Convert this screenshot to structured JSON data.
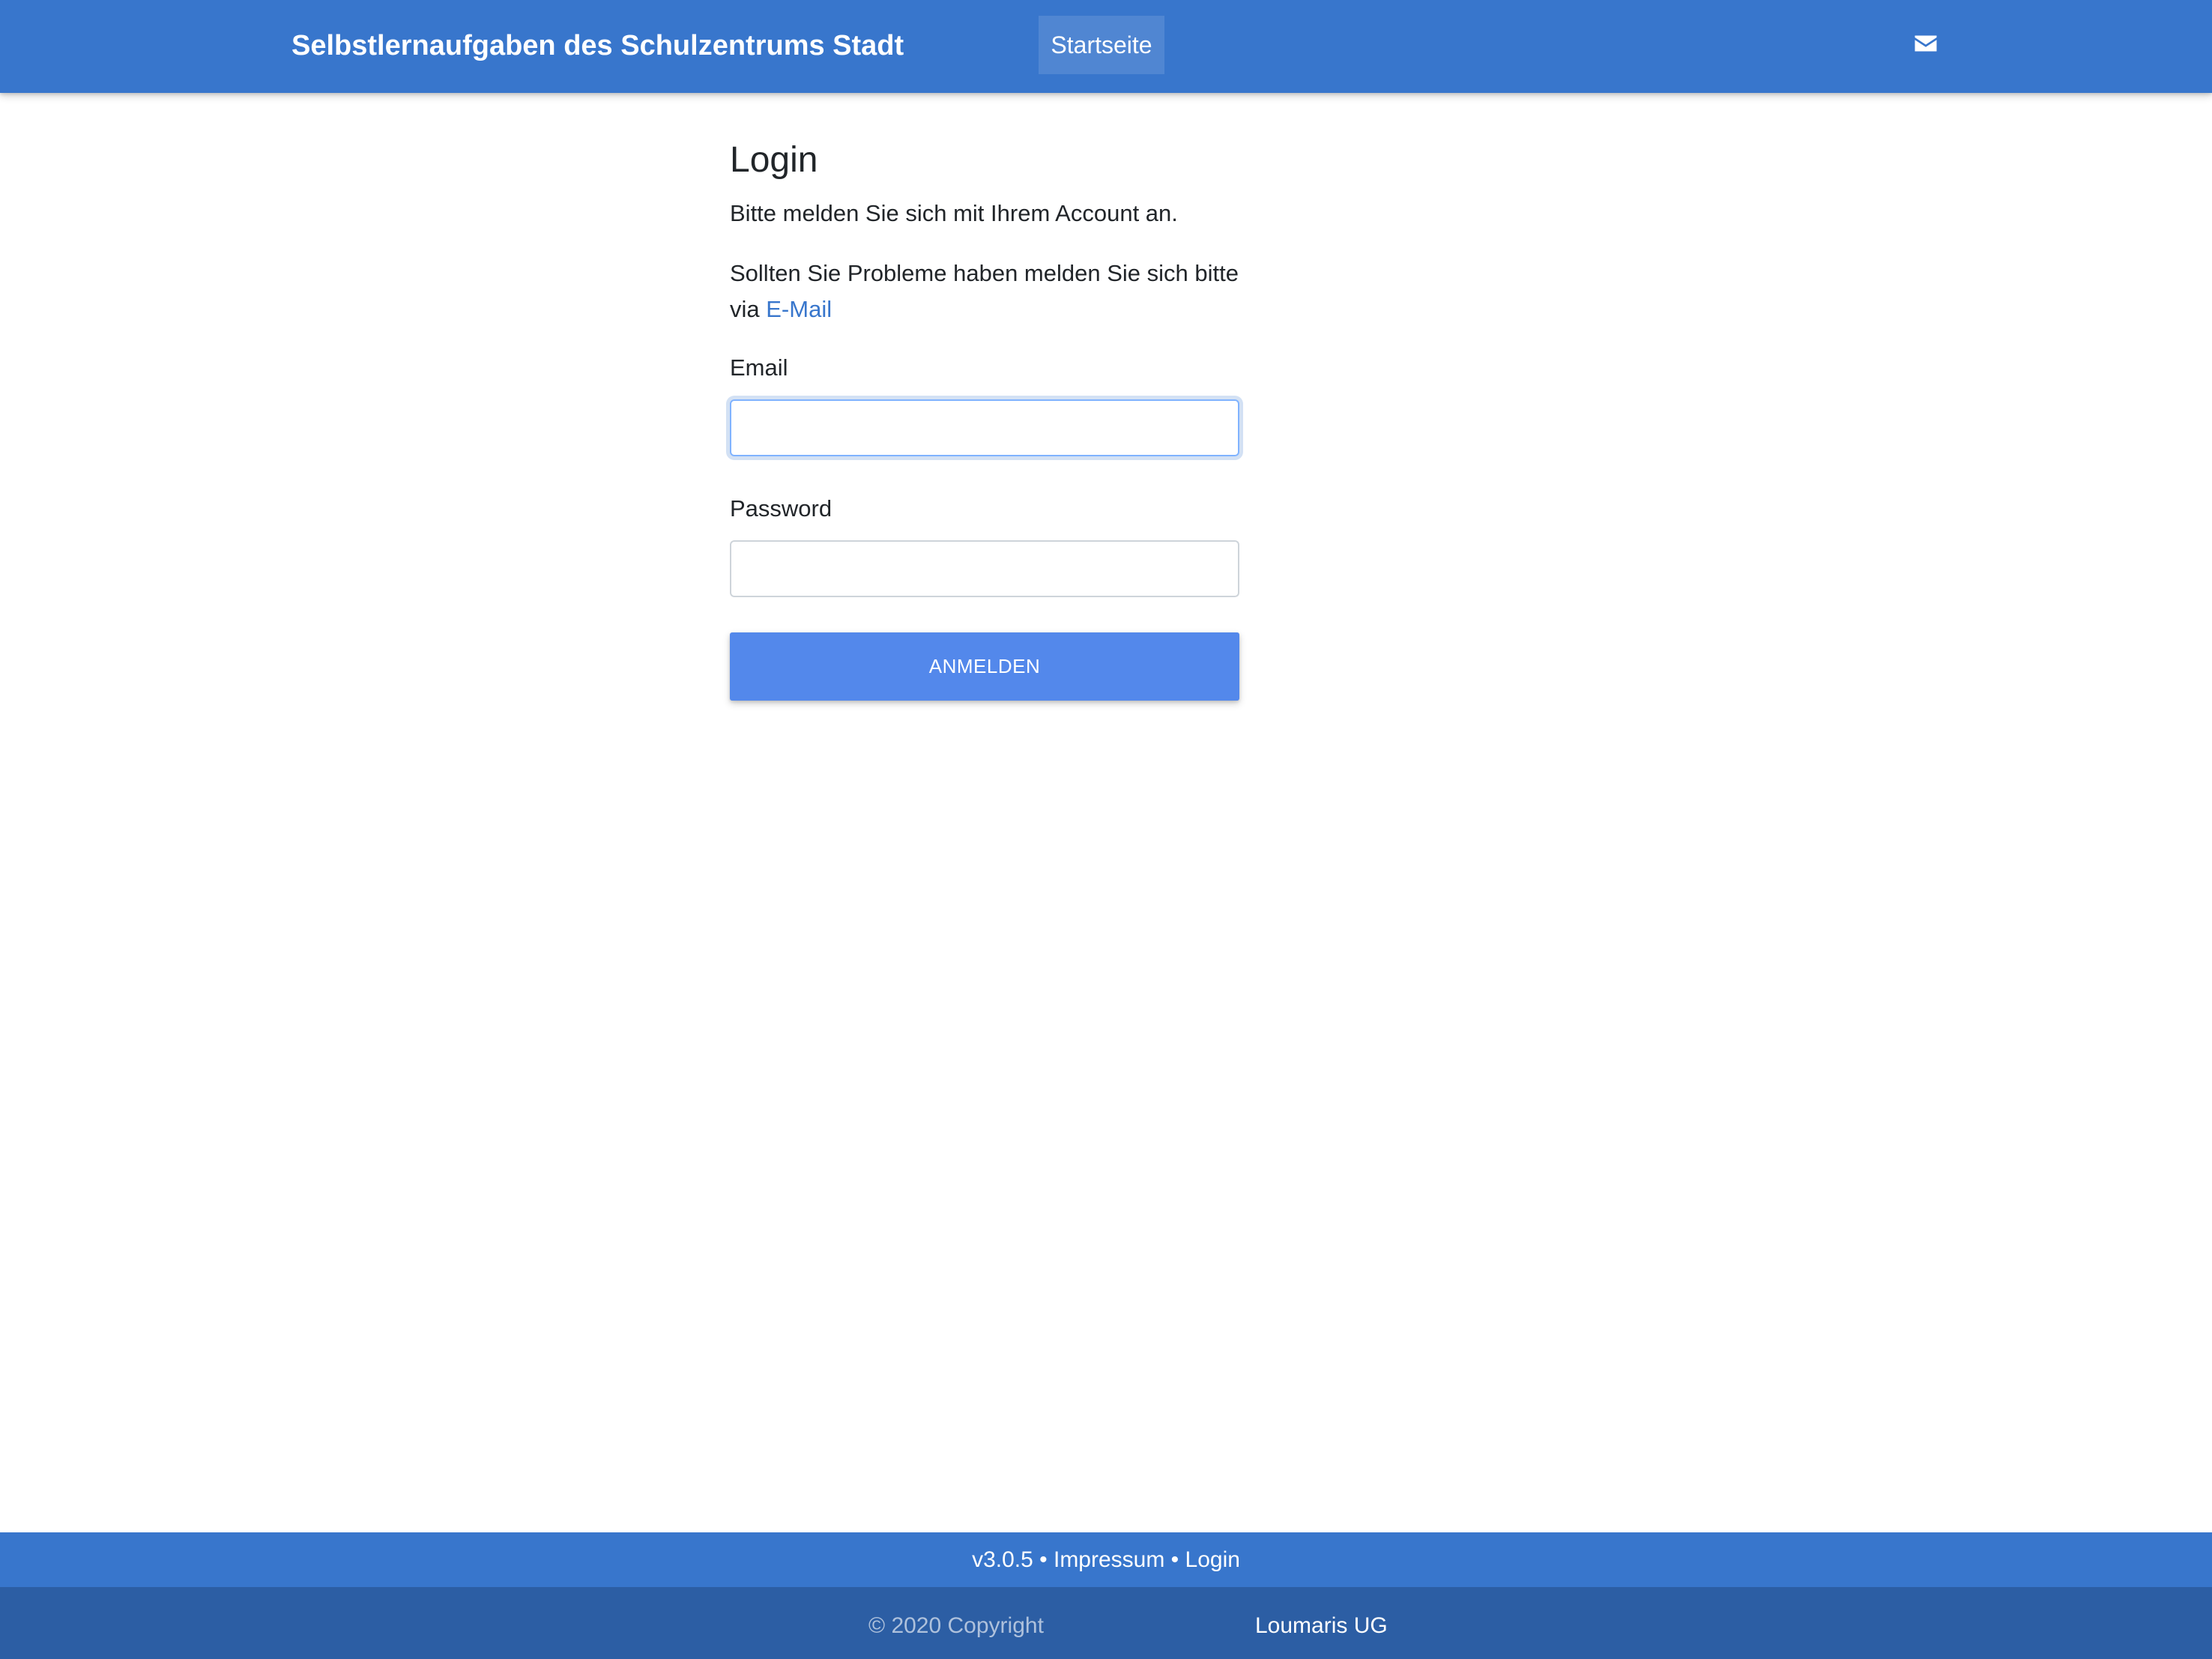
{
  "header": {
    "brand": "Selbstlernaufgaben des Schulzentrums Stadt",
    "nav_active": "Startseite",
    "contact_icon": "envelope-icon"
  },
  "login": {
    "title": "Login",
    "intro": "Bitte melden Sie sich mit Ihrem Account an.",
    "help_text": "Sollten Sie Probleme haben melden Sie sich bitte via ",
    "help_link": "E-Mail",
    "email_label": "Email",
    "email_value": "",
    "password_label": "Password",
    "password_value": "",
    "submit_label": "Anmelden"
  },
  "footer": {
    "version": "v3.0.5",
    "separator": " • ",
    "impressum": "Impressum",
    "login": "Login",
    "copyright": "© 2020 Copyright",
    "company": "Loumaris UG"
  },
  "colors": {
    "primary": "#3876cc",
    "primary_dark": "#2c5ea4",
    "button": "#5388eb"
  }
}
